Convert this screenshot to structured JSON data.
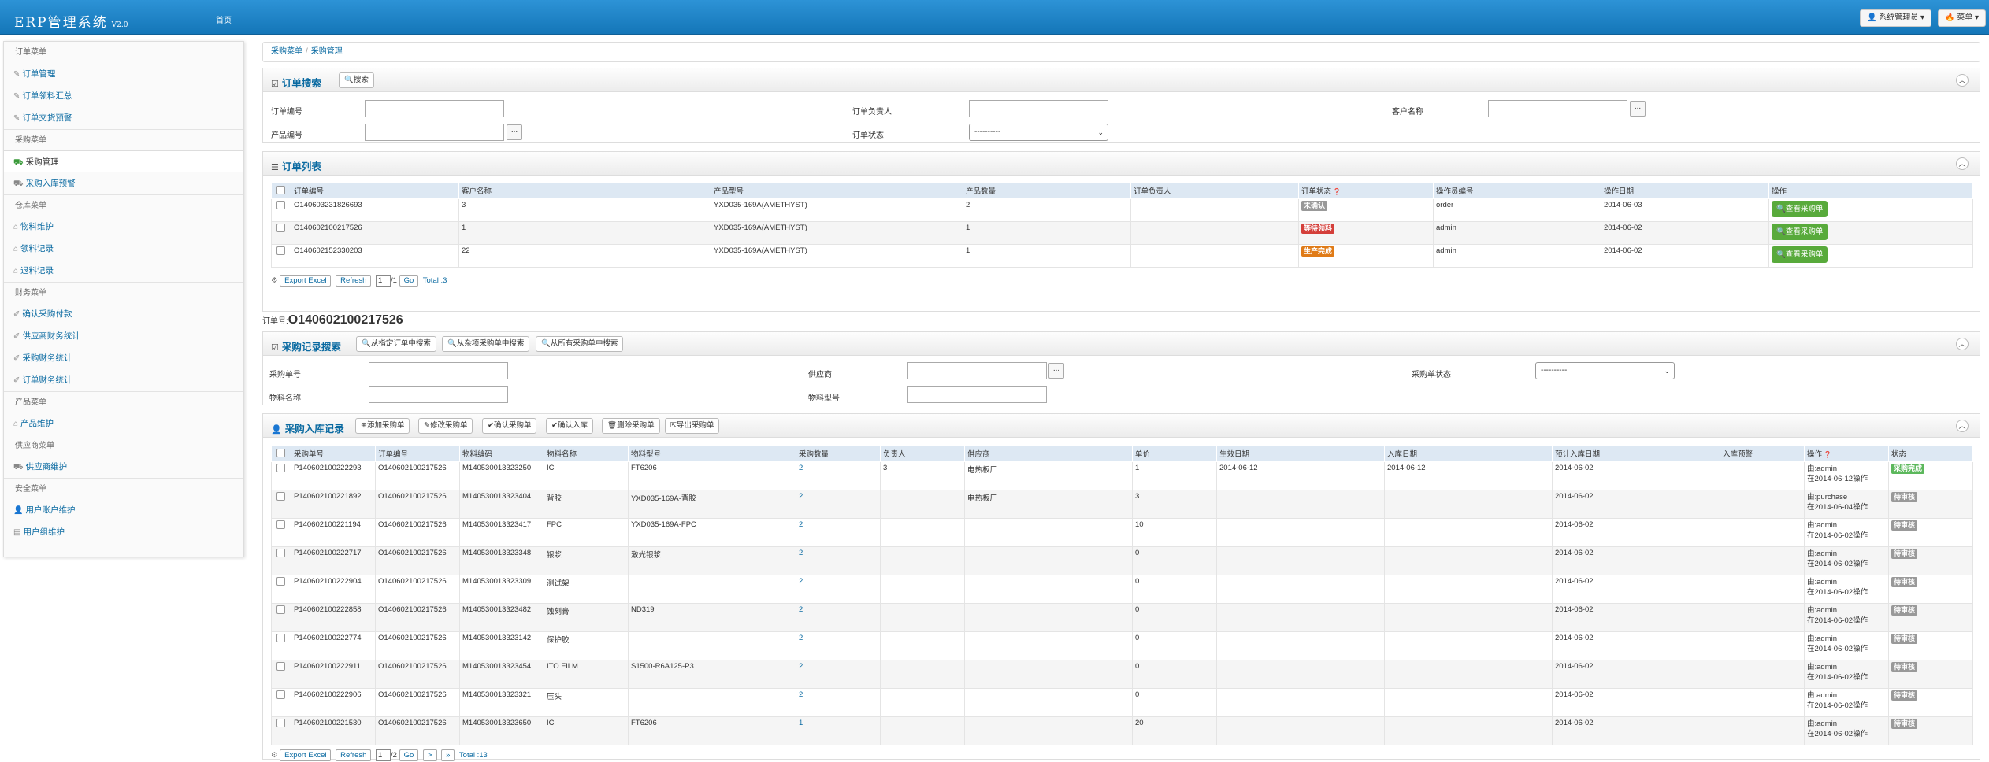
{
  "app": {
    "title": "ERP管理系统",
    "version": "V2.0",
    "home": "首页",
    "user_btn": "系统管理员",
    "menu_btn": "菜单"
  },
  "sidebar": [
    {
      "type": "head",
      "label": "订单菜单"
    },
    {
      "type": "item",
      "icon": "edit-icon",
      "glyph": "✎",
      "label": "订单管理"
    },
    {
      "type": "item",
      "icon": "edit-icon",
      "glyph": "✎",
      "label": "订单领料汇总"
    },
    {
      "type": "item",
      "icon": "edit-icon",
      "glyph": "✎",
      "label": "订单交货预警"
    },
    {
      "type": "head",
      "label": "采购菜单"
    },
    {
      "type": "item",
      "icon": "cart-icon",
      "glyph": "⛟",
      "label": "采购管理",
      "active": true
    },
    {
      "type": "item",
      "icon": "cart-icon",
      "glyph": "⛟",
      "label": "采购入库预警"
    },
    {
      "type": "head",
      "label": "仓库菜单"
    },
    {
      "type": "item",
      "icon": "home-icon",
      "glyph": "⌂",
      "label": "物料维护"
    },
    {
      "type": "item",
      "icon": "home-icon",
      "glyph": "⌂",
      "label": "领料记录"
    },
    {
      "type": "item",
      "icon": "home-icon",
      "glyph": "⌂",
      "label": "退料记录"
    },
    {
      "type": "head",
      "label": "财务菜单"
    },
    {
      "type": "item",
      "icon": "pencil-icon",
      "glyph": "✐",
      "label": "确认采购付款"
    },
    {
      "type": "item",
      "icon": "pencil-icon",
      "glyph": "✐",
      "label": "供应商财务统计"
    },
    {
      "type": "item",
      "icon": "pencil-icon",
      "glyph": "✐",
      "label": "采购财务统计"
    },
    {
      "type": "item",
      "icon": "pencil-icon",
      "glyph": "✐",
      "label": "订单财务统计"
    },
    {
      "type": "head",
      "label": "产品菜单"
    },
    {
      "type": "item",
      "icon": "home-icon",
      "glyph": "⌂",
      "label": "产品维护"
    },
    {
      "type": "head",
      "label": "供应商菜单"
    },
    {
      "type": "item",
      "icon": "cart-icon",
      "glyph": "⛟",
      "label": "供应商维护"
    },
    {
      "type": "head",
      "label": "安全菜单"
    },
    {
      "type": "item",
      "icon": "user-icon",
      "glyph": "👤",
      "label": "用户账户维护"
    },
    {
      "type": "item",
      "icon": "group-icon",
      "glyph": "▤",
      "label": "用户组维护"
    }
  ],
  "breadcrumb": {
    "first": "采购菜单",
    "sep": "/",
    "second": "采购管理"
  },
  "order_search": {
    "title": "订单搜索",
    "search_btn": "搜索",
    "f_order_no": "订单编号",
    "f_owner": "订单负责人",
    "f_customer": "客户名称",
    "f_product": "产品编号",
    "f_status": "订单状态",
    "status_value": "----------",
    "ellipsis": "..."
  },
  "order_list": {
    "title": "订单列表",
    "headers": [
      "订单编号",
      "客户名称",
      "产品型号",
      "产品数量",
      "订单负责人",
      "订单状态",
      "操作员编号",
      "操作日期",
      "操作"
    ],
    "rows": [
      {
        "order_no": "O140603231826693",
        "customer": "3",
        "model": "YXD035-169A(AMETHYST)",
        "qty": "2",
        "owner": "",
        "status": "未确认",
        "status_color": "grey",
        "operator": "order",
        "date": "2014-06-03",
        "action": "查看采购单"
      },
      {
        "order_no": "O140602100217526",
        "customer": "1",
        "model": "YXD035-169A(AMETHYST)",
        "qty": "1",
        "owner": "",
        "status": "等待领料",
        "status_color": "red",
        "operator": "admin",
        "date": "2014-06-02",
        "action": "查看采购单"
      },
      {
        "order_no": "O140602152330203",
        "customer": "22",
        "model": "YXD035-169A(AMETHYST)",
        "qty": "1",
        "owner": "",
        "status": "生产完成",
        "status_color": "orange",
        "operator": "admin",
        "date": "2014-06-02",
        "action": "查看采购单"
      }
    ],
    "pager": {
      "export": "Export Excel",
      "refresh": "Refresh",
      "page": "1",
      "of": "/1",
      "go": "Go",
      "total": "Total :3"
    }
  },
  "order_no": {
    "label": "订单号:",
    "value": "O140602100217526"
  },
  "purchase_search": {
    "title": "采购记录搜索",
    "btn1": "从指定订单中搜索",
    "btn2": "从杂项采购单中搜索",
    "btn3": "从所有采购单中搜索",
    "f_po": "采购单号",
    "f_supplier": "供应商",
    "f_po_status": "采购单状态",
    "f_mat_name": "物料名称",
    "f_mat_model": "物料型号",
    "status_value": "----------",
    "ellipsis": "..."
  },
  "purchase_list": {
    "title": "采购入库记录",
    "buttons": [
      "添加采购单",
      "修改采购单",
      "确认采购单",
      "确认入库",
      "删除采购单",
      "导出采购单"
    ],
    "headers": [
      "采购单号",
      "订单编号",
      "物料编码",
      "物料名称",
      "物料型号",
      "采购数量",
      "负责人",
      "供应商",
      "单价",
      "生效日期",
      "入库日期",
      "预计入库日期",
      "入库预警",
      "操作",
      "状态"
    ],
    "rows": [
      {
        "po": "P140602100222293",
        "order": "O140602100217526",
        "code": "M140530013323250",
        "name": "IC",
        "model": "FT6206",
        "qty": "2",
        "owner": "3",
        "supplier": "电热板厂",
        "price": "1",
        "eff": "2014-06-12",
        "in": "2014-06-12",
        "exp": "2014-06-02",
        "warn": "",
        "op1": "由:admin",
        "op2": "在2014-06-12操作",
        "status": "采购完成",
        "status_color": "green"
      },
      {
        "po": "P140602100221892",
        "order": "O140602100217526",
        "code": "M140530013323404",
        "name": "背胶",
        "model": "YXD035-169A-背胶",
        "qty": "2",
        "owner": "",
        "supplier": "电热板厂",
        "price": "3",
        "eff": "",
        "in": "",
        "exp": "2014-06-02",
        "warn": "",
        "op1": "由:purchase",
        "op2": "在2014-06-04操作",
        "status": "待审核",
        "status_color": "grey"
      },
      {
        "po": "P140602100221194",
        "order": "O140602100217526",
        "code": "M140530013323417",
        "name": "FPC",
        "model": "YXD035-169A-FPC",
        "qty": "2",
        "owner": "",
        "supplier": "",
        "price": "10",
        "eff": "",
        "in": "",
        "exp": "2014-06-02",
        "warn": "",
        "op1": "由:admin",
        "op2": "在2014-06-02操作",
        "status": "待审核",
        "status_color": "grey"
      },
      {
        "po": "P140602100222717",
        "order": "O140602100217526",
        "code": "M140530013323348",
        "name": "银浆",
        "model": "激光银浆",
        "qty": "2",
        "owner": "",
        "supplier": "",
        "price": "0",
        "eff": "",
        "in": "",
        "exp": "2014-06-02",
        "warn": "",
        "op1": "由:admin",
        "op2": "在2014-06-02操作",
        "status": "待审核",
        "status_color": "grey"
      },
      {
        "po": "P140602100222904",
        "order": "O140602100217526",
        "code": "M140530013323309",
        "name": "测试架",
        "model": "",
        "qty": "2",
        "owner": "",
        "supplier": "",
        "price": "0",
        "eff": "",
        "in": "",
        "exp": "2014-06-02",
        "warn": "",
        "op1": "由:admin",
        "op2": "在2014-06-02操作",
        "status": "待审核",
        "status_color": "grey"
      },
      {
        "po": "P140602100222858",
        "order": "O140602100217526",
        "code": "M140530013323482",
        "name": "蚀刻膏",
        "model": "ND319",
        "qty": "2",
        "owner": "",
        "supplier": "",
        "price": "0",
        "eff": "",
        "in": "",
        "exp": "2014-06-02",
        "warn": "",
        "op1": "由:admin",
        "op2": "在2014-06-02操作",
        "status": "待审核",
        "status_color": "grey"
      },
      {
        "po": "P140602100222774",
        "order": "O140602100217526",
        "code": "M140530013323142",
        "name": "保护胶",
        "model": "",
        "qty": "2",
        "owner": "",
        "supplier": "",
        "price": "0",
        "eff": "",
        "in": "",
        "exp": "2014-06-02",
        "warn": "",
        "op1": "由:admin",
        "op2": "在2014-06-02操作",
        "status": "待审核",
        "status_color": "grey"
      },
      {
        "po": "P140602100222911",
        "order": "O140602100217526",
        "code": "M140530013323454",
        "name": "ITO FILM",
        "model": "S1500-R6A125-P3",
        "qty": "2",
        "owner": "",
        "supplier": "",
        "price": "0",
        "eff": "",
        "in": "",
        "exp": "2014-06-02",
        "warn": "",
        "op1": "由:admin",
        "op2": "在2014-06-02操作",
        "status": "待审核",
        "status_color": "grey"
      },
      {
        "po": "P140602100222906",
        "order": "O140602100217526",
        "code": "M140530013323321",
        "name": "压头",
        "model": "",
        "qty": "2",
        "owner": "",
        "supplier": "",
        "price": "0",
        "eff": "",
        "in": "",
        "exp": "2014-06-02",
        "warn": "",
        "op1": "由:admin",
        "op2": "在2014-06-02操作",
        "status": "待审核",
        "status_color": "grey"
      },
      {
        "po": "P140602100221530",
        "order": "O140602100217526",
        "code": "M140530013323650",
        "name": "IC",
        "model": "FT6206",
        "qty": "1",
        "owner": "",
        "supplier": "",
        "price": "20",
        "eff": "",
        "in": "",
        "exp": "2014-06-02",
        "warn": "",
        "op1": "由:admin",
        "op2": "在2014-06-02操作",
        "status": "待审核",
        "status_color": "grey"
      }
    ],
    "pager": {
      "export": "Export Excel",
      "refresh": "Refresh",
      "page": "1",
      "of": "/2",
      "go": "Go",
      "next": ">",
      "last": "»",
      "total": "Total :13"
    }
  },
  "colors": {
    "topbar": "#1a80c4",
    "link": "#0a6aa1",
    "header_bg": "#dde8f3",
    "green": "#58aa3b",
    "red": "#d43f3a",
    "orange": "#e07b17",
    "grey": "#999999"
  }
}
